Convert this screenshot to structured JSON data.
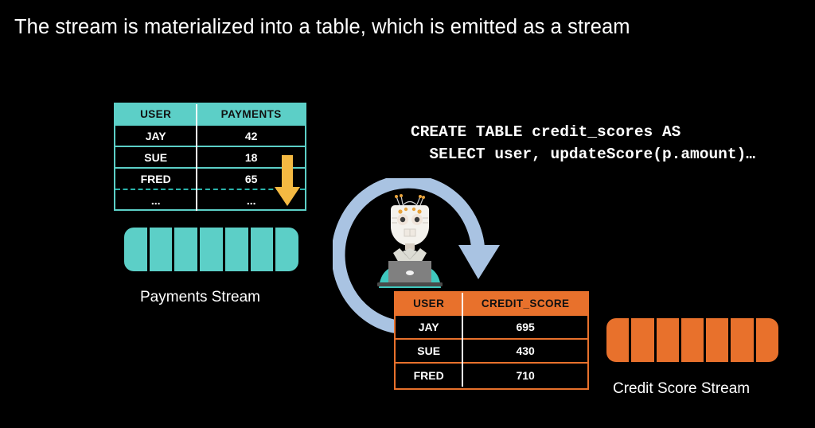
{
  "slide": {
    "title": "The stream is materialized into a table, which is emitted as a stream",
    "background_color": "#000000",
    "text_color": "#ffffff"
  },
  "code_block": {
    "line1": "CREATE TABLE credit_scores AS",
    "line2": "  SELECT user, updateScore(p.amount)…"
  },
  "payments_table": {
    "accent_color": "#5CCFC7",
    "headers": [
      "USER",
      "PAYMENTS"
    ],
    "rows": [
      [
        "JAY",
        "42"
      ],
      [
        "SUE",
        "18"
      ],
      [
        "FRED",
        "65"
      ],
      [
        "...",
        "..."
      ]
    ]
  },
  "credit_table": {
    "accent_color": "#E8712C",
    "headers": [
      "USER",
      "CREDIT_SCORE"
    ],
    "rows": [
      [
        "JAY",
        "695"
      ],
      [
        "SUE",
        "430"
      ],
      [
        "FRED",
        "710"
      ]
    ]
  },
  "payments_stream": {
    "label": "Payments Stream",
    "color": "#5CCFC7",
    "segments": 7
  },
  "credit_stream": {
    "label": "Credit Score Stream",
    "color": "#E8712C",
    "segments": 7
  },
  "icons": {
    "down_arrow": {
      "name": "down-arrow-icon",
      "color": "#F4B942"
    },
    "cycle_arrow": {
      "name": "circular-refresh-arrow-icon",
      "color": "#A9C3E2"
    },
    "robot": {
      "name": "robot-at-laptop-icon",
      "shirt_color": "#3FC8BE",
      "laptop_color": "#808080"
    }
  }
}
